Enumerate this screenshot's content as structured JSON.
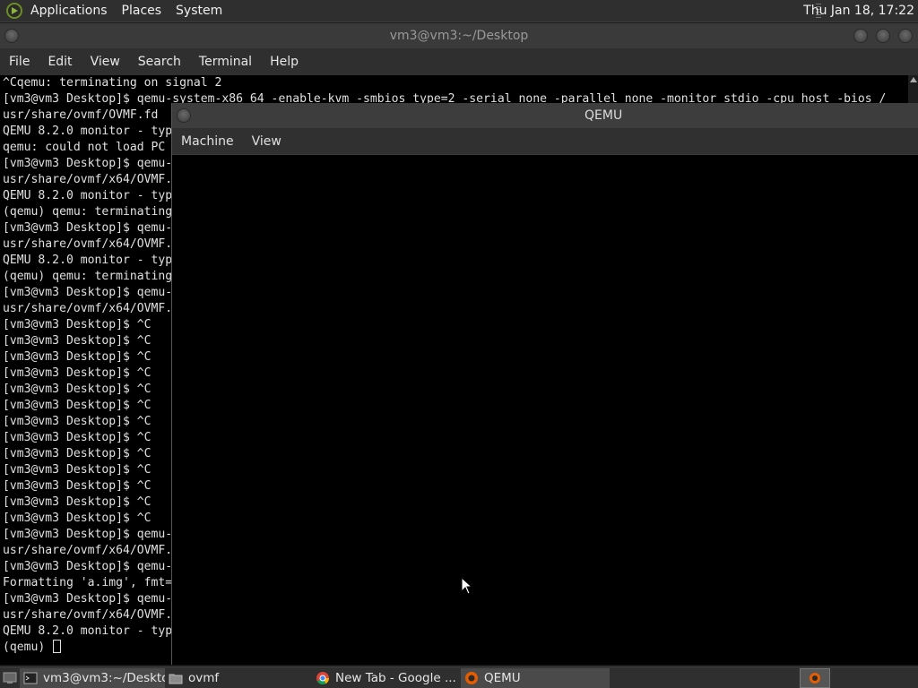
{
  "top_panel": {
    "menus": [
      "Applications",
      "Places",
      "System"
    ],
    "clock": "Thu Jan 18, 17:22"
  },
  "terminal": {
    "title": "vm3@vm3:~/Desktop",
    "menus": [
      "File",
      "Edit",
      "View",
      "Search",
      "Terminal",
      "Help"
    ],
    "lines": [
      "^Cqemu: terminating on signal 2",
      "[vm3@vm3 Desktop]$ qemu-system-x86_64 -enable-kvm -smbios type=2 -serial none -parallel none -monitor stdio -cpu host -bios /",
      "usr/share/ovmf/OVMF.fd",
      "QEMU 8.2.0 monitor - typ",
      "qemu: could not load PC ",
      "[vm3@vm3 Desktop]$ qemu-",
      "usr/share/ovmf/x64/OVMF.",
      "QEMU 8.2.0 monitor - typ",
      "(qemu) qemu: terminating",
      "[vm3@vm3 Desktop]$ qemu-",
      "usr/share/ovmf/x64/OVMF.",
      "QEMU 8.2.0 monitor - typ",
      "(qemu) qemu: terminating",
      "[vm3@vm3 Desktop]$ qemu-",
      "usr/share/ovmf/x64/OVMF.",
      "[vm3@vm3 Desktop]$ ^C",
      "[vm3@vm3 Desktop]$ ^C",
      "[vm3@vm3 Desktop]$ ^C",
      "[vm3@vm3 Desktop]$ ^C",
      "[vm3@vm3 Desktop]$ ^C",
      "[vm3@vm3 Desktop]$ ^C",
      "[vm3@vm3 Desktop]$ ^C",
      "[vm3@vm3 Desktop]$ ^C",
      "[vm3@vm3 Desktop]$ ^C",
      "[vm3@vm3 Desktop]$ ^C",
      "[vm3@vm3 Desktop]$ ^C",
      "[vm3@vm3 Desktop]$ ^C",
      "[vm3@vm3 Desktop]$ ^C",
      "[vm3@vm3 Desktop]$ qemu-",
      "usr/share/ovmf/x64/OVMF.",
      "[vm3@vm3 Desktop]$ qemu-",
      "Formatting 'a.img', fmt=",
      "[vm3@vm3 Desktop]$ qemu-",
      "usr/share/ovmf/x64/OVMF.",
      "QEMU 8.2.0 monitor - typ"
    ],
    "prompt": "(qemu) "
  },
  "qemu": {
    "title": "QEMU",
    "menus": [
      "Machine",
      "View"
    ]
  },
  "taskbar": {
    "items": [
      {
        "label": "vm3@vm3:~/Desktop",
        "icon": "terminal-icon"
      },
      {
        "label": "ovmf",
        "icon": "folder-icon"
      },
      {
        "label": "New Tab - Google ...",
        "icon": "chrome-icon"
      },
      {
        "label": "QEMU",
        "icon": "qemu-icon"
      }
    ]
  },
  "colors": {
    "panel": "#2f2f2f",
    "terminal_bg": "#000000",
    "terminal_fg": "#e0e0e0"
  }
}
